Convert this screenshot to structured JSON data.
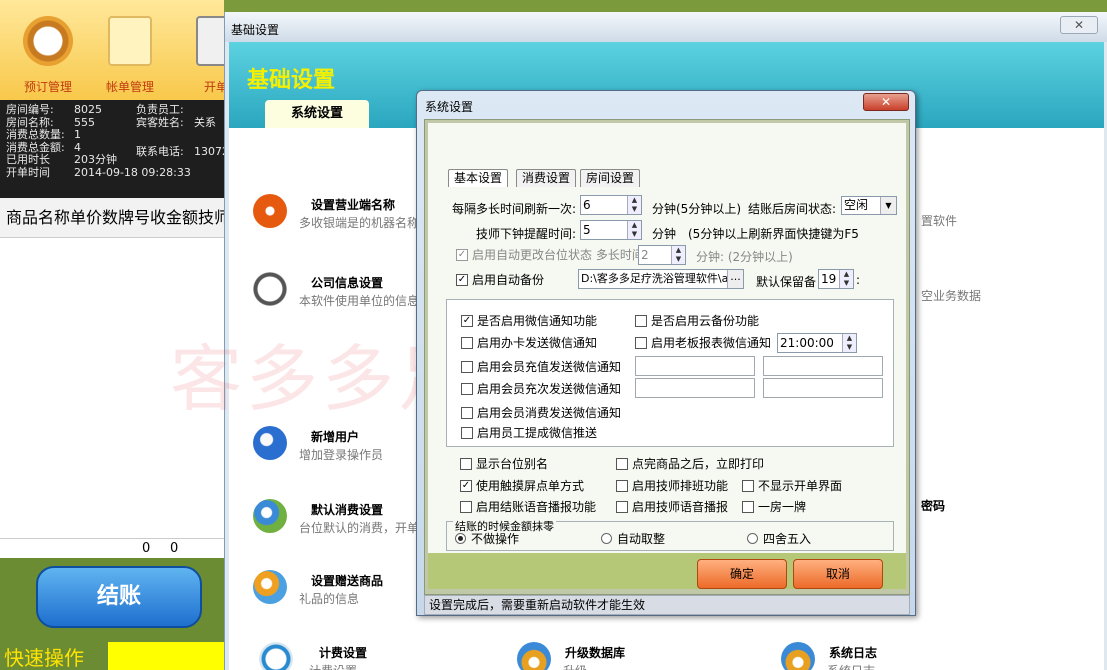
{
  "left_app": {
    "toolbar": [
      {
        "label": "预订管理",
        "icon": "alarm-clock-icon"
      },
      {
        "label": "帐单管理",
        "icon": "bill-note-icon"
      },
      {
        "label": "开单",
        "icon": "clipboard-icon"
      }
    ],
    "room_info": {
      "room_no_label": "房间编号:",
      "room_no": "8025",
      "room_name_label": "房间名称:",
      "room_name": "555",
      "item_count_label": "消费总数量:",
      "item_count": "1",
      "total_amount_label": "消费总金额:",
      "total_amount": "4",
      "used_time_label": "已用时长",
      "used_time": "203分钟",
      "open_time_label": "开单时间",
      "open_time": "2014-09-18 09:28:33",
      "staff_label": "负责员工:",
      "guest_label": "宾客姓名:",
      "guest_name": "关系",
      "phone_label": "联系电话:",
      "phone": "130726"
    },
    "items_header": "商品名称单价数牌号收金额技师",
    "totals": {
      "qty": "0",
      "amount": "0"
    },
    "checkout_label": "结账",
    "quick_label": "快速操作"
  },
  "settings_window": {
    "title": "基础设置",
    "close_label": "✕",
    "heading": "基础设置",
    "active_tab": "系统设置",
    "watermark": "客多多足疗洗浴系统",
    "features": {
      "terminal": {
        "title": "设置营业端名称",
        "desc": "多收银端是的机器名称"
      },
      "company": {
        "title": "公司信息设置",
        "desc": "本软件使用单位的信息"
      },
      "user": {
        "title": "新增用户",
        "desc": "增加登录操作员"
      },
      "default_consume": {
        "title": "默认消费设置",
        "desc": "台位默认的消费，开单"
      },
      "gift": {
        "title": "设置赠送商品",
        "desc": "礼品的信息"
      },
      "billing": {
        "title": "计费设置",
        "desc": "计费设置"
      },
      "upgrade": {
        "title": "升级数据库",
        "desc": "升级"
      },
      "log": {
        "title": "系统日志",
        "desc": "系统日志"
      }
    },
    "right_snippets": {
      "r1": "置软件",
      "r2": "空业务数据",
      "r3": "密码"
    }
  },
  "sys_dialog": {
    "title": "系统设置",
    "close_label": "✕",
    "tabs": [
      "基本设置",
      "消费设置",
      "房间设置"
    ],
    "refresh_label": "每隔多长时间刷新一次:",
    "refresh_value": "6",
    "refresh_unit": "分钟(5分钟以上)",
    "checkout_status_label": "结账后房间状态:",
    "checkout_status_value": "空闲",
    "tech_remind_label": "技师下钟提醒时间:",
    "tech_remind_value": "5",
    "tech_remind_unit": "分钟",
    "tech_remind_note": "(5分钟以上刷新界面快捷键为F5",
    "auto_status_label": "启用自动更改台位状态 多长时间",
    "auto_status_value": "2",
    "auto_status_unit": "分钟: (2分钟以上)",
    "auto_backup_label": "启用自动备份",
    "backup_path": "D:\\客多多足疗洗浴管理软件\\aut",
    "backup_path_btn": "...",
    "keep_days_label": "默认保留备",
    "keep_days_value": "19",
    "keep_days_suffix": ":",
    "wechat_options": [
      {
        "label": "是否启用微信通知功能",
        "checked": true
      },
      {
        "label": "是否启用云备份功能",
        "checked": false
      },
      {
        "label": "启用办卡发送微信通知",
        "checked": false
      },
      {
        "label": "启用老板报表微信通知",
        "checked": false
      },
      {
        "label": "启用会员充值发送微信通知",
        "checked": false
      },
      {
        "label": "启用会员充次发送微信通知",
        "checked": false
      },
      {
        "label": "启用会员消费发送微信通知",
        "checked": false
      },
      {
        "label": "启用员工提成微信推送",
        "checked": false
      }
    ],
    "report_time": "21:00:00",
    "misc_options": [
      {
        "label": "显示台位别名",
        "checked": false
      },
      {
        "label": "点完商品之后，立即打印",
        "checked": false
      },
      {
        "label": "使用触摸屏点单方式",
        "checked": true
      },
      {
        "label": "启用技师排班功能",
        "checked": false
      },
      {
        "label": "不显示开单界面",
        "checked": false
      },
      {
        "label": "启用结账语音播报功能",
        "checked": false
      },
      {
        "label": "启用技师语音播报",
        "checked": false
      },
      {
        "label": "一房一牌",
        "checked": false
      }
    ],
    "rounding_group_label": "结账的时候金额抹零",
    "rounding_options": [
      {
        "label": "不做操作",
        "selected": true
      },
      {
        "label": "自动取整",
        "selected": false
      },
      {
        "label": "四舍五入",
        "selected": false
      }
    ],
    "ok_label": "确定",
    "cancel_label": "取消",
    "status_text": "设置完成后，需要重新启动软件才能生效"
  }
}
